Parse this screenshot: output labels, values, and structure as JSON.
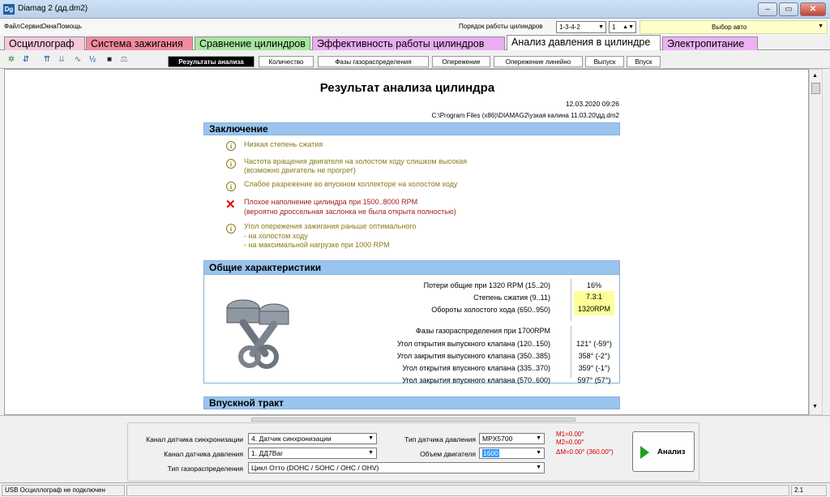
{
  "window": {
    "title": "Diamag 2 (дд.dm2)"
  },
  "menu": {
    "items": [
      "Файл",
      "Сервис",
      "Окна",
      "Помощь"
    ],
    "cyl_order_label": "Порядок работы цилиндров",
    "cyl_order_value": "1-3-4-2",
    "cyl_num": "1",
    "choose_car": "Выбор авто"
  },
  "main_tabs": [
    {
      "label": "Осциллограф",
      "color": "#f6c8dc"
    },
    {
      "label": "Система зажигания",
      "color": "#f38ba0"
    },
    {
      "label": "Сравнение цилиндров",
      "color": "#a8e6a0"
    },
    {
      "label": "Эффективность работы цилиндров",
      "color": "#e8aef0"
    },
    {
      "label": "Анализ давления в цилиндре",
      "color": "#ffffff"
    },
    {
      "label": "Электропитание",
      "color": "#ebb3f2"
    }
  ],
  "sub_tabs": [
    "Результаты анализа",
    "Количество",
    "Фазы газораспределения",
    "Опережение",
    "Опережение линейно",
    "Выпуск",
    "Впуск"
  ],
  "report": {
    "title": "Результат анализа цилиндра",
    "date": "12.03.2020 09:26",
    "path": "C:\\Program Files (x86)\\DIAMAG2\\узкая калина 11.03.20\\дд.dm2",
    "conclusion_header": "Заключение",
    "c1": "Низкая степень сжатия",
    "c2a": "Частота вращения двигателя на холостом ходу слишком высокая",
    "c2b": "(возможно двигатель не прогрет)",
    "c3": "Слабое разрежение во впускном коллекторе на холостом ходу",
    "c4a": "Плохое наполнение цилиндра при 1500..8000 RPM",
    "c4b": "(вероятно дроссельная заслонка не была открыта полностью)",
    "c5a": "Угол опережения зажигания раньше оптимального",
    "c5b": "- на холостом ходу",
    "c5c": "- на максимальной нагрузке при 1000 RPM",
    "general_header": "Общие характеристики",
    "g1_label": "Потери общие при 1320 RPM (15..20)",
    "g1_value": "16%",
    "g2_label": "Степень сжатия (9..11)",
    "g2_value": "7.3:1",
    "g3_label": "Обороты холостого хода (650..950)",
    "g3_value": "1320RPM",
    "g4_label": "Фазы газораспределения при 1700RPM",
    "g5_label": "Угол открытия выпускного клапана (120..150)",
    "g5_value": "121° (-59°)",
    "g6_label": "Угол закрытия выпускного клапана (350..385)",
    "g6_value": "358° (-2°)",
    "g7_label": "Угол открытия впускного клапана (335..370)",
    "g7_value": "359° (-1°)",
    "g8_label": "Угол закрытия впускного клапана (570..600)",
    "g8_value": "597° (57°)",
    "intake_header": "Впускной тракт"
  },
  "bottom": {
    "sync_label": "Канал датчика синхронизации",
    "sync_value": "4. Датчик синхронизации",
    "pressure_ch_label": "Канал датчика давления",
    "pressure_ch_value": "1. ДД7Bar",
    "timing_label": "Тип газораспределения",
    "timing_value": "Цикл Отто (DOHC / SOHC / OHC / OHV)",
    "sensor_type_label": "Тип датчика давления",
    "sensor_type_value": "MPX5700",
    "volume_label": "Объем двигателя",
    "volume_value": "1600",
    "m1": "M1=0.00°",
    "m2": "M2=0.00°",
    "dm": "ΔM=0.00° (360.00°)",
    "analyze": "Анализ"
  },
  "status": {
    "left": "USB Осциллограф не подключен",
    "right": "2.1"
  },
  "colors": {
    "header_blue": "#99c4ee",
    "warn": "#8a7a15",
    "error": "#a11d1d",
    "highlight": "#ffff99",
    "marker_red": "#d00000"
  }
}
